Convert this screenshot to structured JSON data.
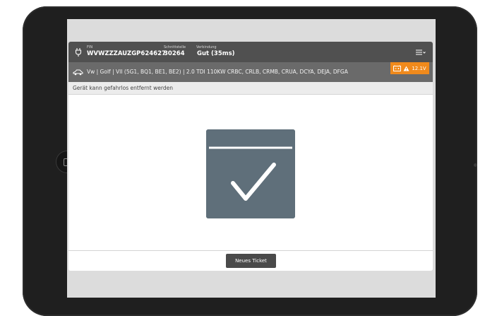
{
  "header": {
    "fin_label": "FIN",
    "fin_value": "WVWZZZAUZGP624627",
    "interface_label": "Schnittstelle",
    "interface_value": "30264",
    "connection_label": "Verbindung",
    "connection_value": "Gut (35ms)",
    "menu_icon": "hamburger-chevron-icon"
  },
  "vehicle": {
    "description": "Vw | Golf | VII (5G1, BQ1, BE1, BE2) | 2.0 TDI 110KW CRBC, CRLB, CRMB, CRUA, DCYA, DEJA, DFGA",
    "icon": "car-icon"
  },
  "battery": {
    "voltage": "12.1V",
    "icons": [
      "battery-icon",
      "warning-icon"
    ],
    "color": "#f08a1c"
  },
  "status": {
    "message": "Gerät kann gefahrlos entfernt werden"
  },
  "main": {
    "icon": "checkmark-icon",
    "icon_color": "#5f6f7a"
  },
  "footer": {
    "new_ticket_label": "Neues Ticket"
  },
  "colors": {
    "header_bg": "#505050",
    "vehicle_bg": "#6a6a6a",
    "accent": "#f08a1c"
  }
}
